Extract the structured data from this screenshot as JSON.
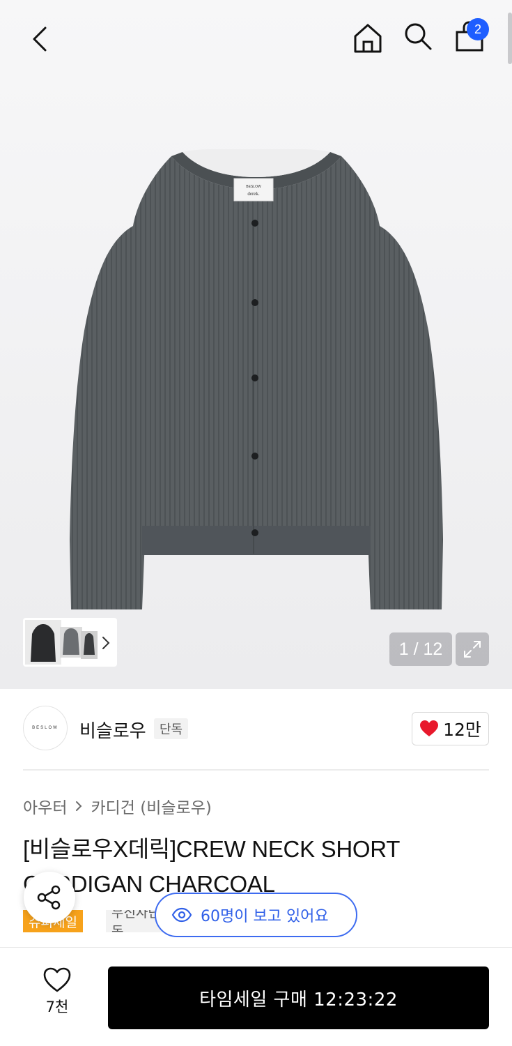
{
  "header": {
    "back_icon": "chevron-left-icon",
    "home_icon": "home-icon",
    "search_icon": "search-icon",
    "cart_icon": "shopping-bag-icon",
    "cart_count": "2",
    "badge_color": "#1e5eff"
  },
  "gallery": {
    "counter": "1 / 12",
    "label_brand": "BESLOW",
    "label_sub": "derek.",
    "thumb_next_icon": "chevron-right-icon",
    "fullscreen_icon": "expand-icon"
  },
  "brand": {
    "logo_text": "BESLOW",
    "name": "비슬로우",
    "exclusive": "단독",
    "like_count": "12만",
    "heart_color": "#e8192c"
  },
  "breadcrumb": {
    "category": "아우터",
    "subcategory": "카디건 (비슬로우)"
  },
  "product": {
    "title": "[비슬로우X데릭]CREW NECK SHORT CARDIGAN CHARCOAL",
    "tag_sale": "슈퍼세일",
    "tag_musinsa": "무신사단독"
  },
  "overlay": {
    "share_icon": "share-icon",
    "viewers_text": "60명이 보고 있어요",
    "viewers_color": "#2f5fe8"
  },
  "footer": {
    "wish_count": "7천",
    "buy_label": "타임세일 구매 12:23:22"
  }
}
